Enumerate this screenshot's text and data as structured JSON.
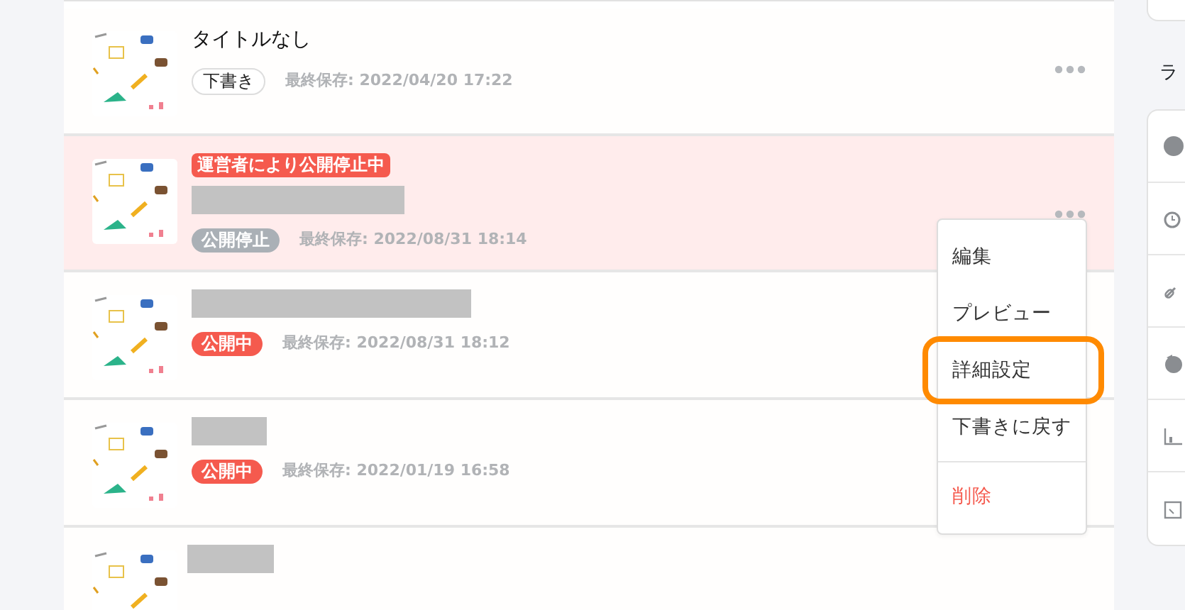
{
  "articles": [
    {
      "kind": "draft",
      "title": "タイトルなし",
      "status": "下書き",
      "saved": "最終保存: 2022/04/20 17:22",
      "suspended": false
    },
    {
      "kind": "suspended",
      "status": "公開停止",
      "saved": "最終保存: 2022/08/31 18:14",
      "banner_text": "運営者により公開停止中",
      "suspended": true
    },
    {
      "kind": "published",
      "status": "公開中",
      "saved": "最終保存: 2022/08/31 18:12",
      "suspended": false
    },
    {
      "kind": "published",
      "status": "公開中",
      "saved": "最終保存: 2022/01/19 16:58",
      "suspended": false
    },
    {
      "kind": "partial",
      "suspended": false
    }
  ],
  "menu": {
    "items": [
      {
        "label": "編集",
        "kind": "normal",
        "highlighted": false
      },
      {
        "label": "プレビュー",
        "kind": "normal",
        "highlighted": false
      },
      {
        "label": "詳細設定",
        "kind": "normal",
        "highlighted": true
      },
      {
        "label": "下書きに戻す",
        "kind": "normal",
        "highlighted": false
      },
      {
        "label": "削除",
        "kind": "danger",
        "highlighted": false
      }
    ]
  },
  "side": {
    "heading": "ラ"
  }
}
